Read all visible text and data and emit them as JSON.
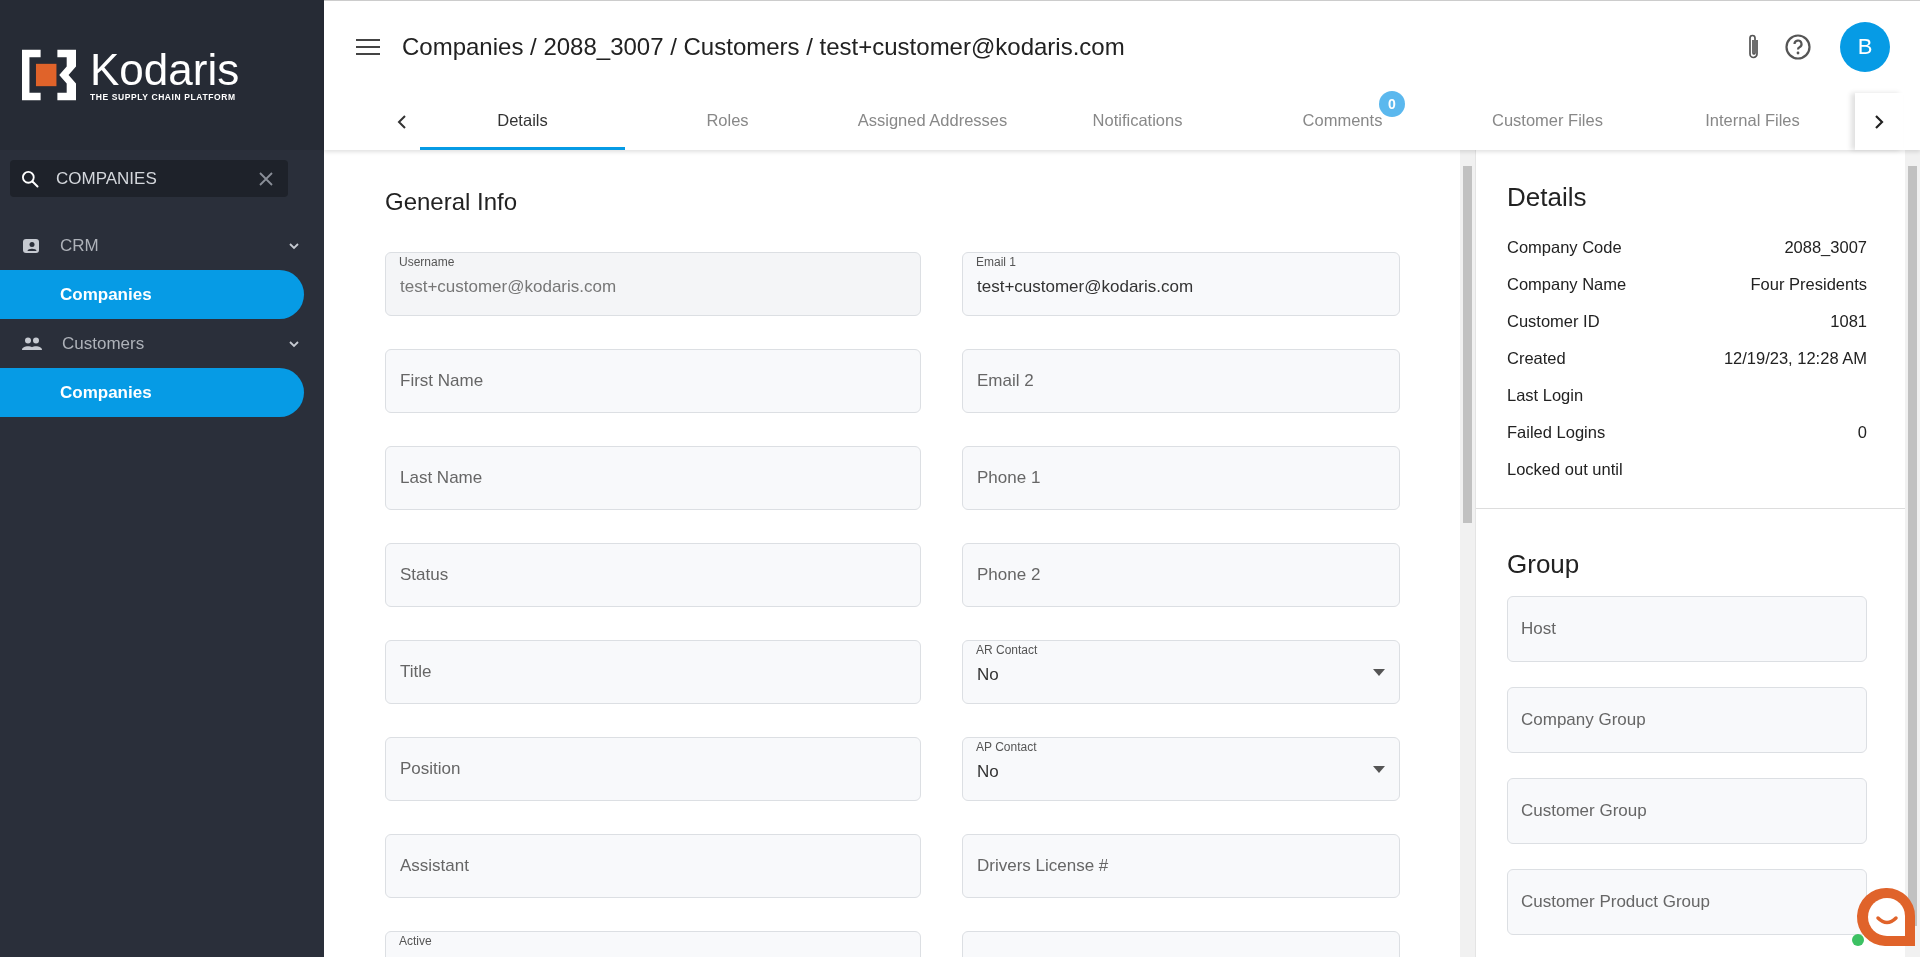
{
  "sidebar": {
    "logo": {
      "name": "Kodaris",
      "tagline": "THE SUPPLY CHAIN PLATFORM"
    },
    "search": {
      "value": "COMPANIES"
    },
    "groups": [
      {
        "label": "CRM",
        "expanded": true,
        "children": [
          {
            "label": "Companies",
            "selected": true
          }
        ]
      },
      {
        "label": "Customers",
        "expanded": true,
        "children": [
          {
            "label": "Companies",
            "selected": true
          }
        ]
      }
    ]
  },
  "header": {
    "breadcrumb": "Companies / 2088_3007 / Customers / test+customer@kodaris.com",
    "avatar": "B"
  },
  "tabs": [
    {
      "label": "Details",
      "selected": true
    },
    {
      "label": "Roles",
      "selected": false
    },
    {
      "label": "Assigned Addresses",
      "selected": false
    },
    {
      "label": "Notifications",
      "selected": false
    },
    {
      "label": "Comments",
      "selected": false,
      "badge": "0"
    },
    {
      "label": "Customer Files",
      "selected": false
    },
    {
      "label": "Internal Files",
      "selected": false
    }
  ],
  "form": {
    "title": "General Info",
    "rows": [
      [
        {
          "kind": "text",
          "label": "Username",
          "value": "test+customer@kodaris.com",
          "disabled": true
        },
        {
          "kind": "text",
          "label": "Email 1",
          "value": "test+customer@kodaris.com",
          "disabled": false
        }
      ],
      [
        {
          "kind": "text",
          "placeholder": "First Name",
          "disabled": false
        },
        {
          "kind": "text",
          "placeholder": "Email 2",
          "disabled": false
        }
      ],
      [
        {
          "kind": "text",
          "placeholder": "Last Name",
          "disabled": false
        },
        {
          "kind": "text",
          "placeholder": "Phone 1",
          "disabled": false
        }
      ],
      [
        {
          "kind": "text",
          "placeholder": "Status",
          "disabled": false
        },
        {
          "kind": "text",
          "placeholder": "Phone 2",
          "disabled": false
        }
      ],
      [
        {
          "kind": "text",
          "placeholder": "Title",
          "disabled": false
        },
        {
          "kind": "select",
          "label": "AR Contact",
          "value": "No",
          "disabled": false
        }
      ],
      [
        {
          "kind": "text",
          "placeholder": "Position",
          "disabled": false
        },
        {
          "kind": "select",
          "label": "AP Contact",
          "value": "No",
          "disabled": false
        }
      ],
      [
        {
          "kind": "text",
          "placeholder": "Assistant",
          "disabled": false
        },
        {
          "kind": "text",
          "placeholder": "Drivers License #",
          "disabled": false
        }
      ],
      [
        {
          "kind": "text",
          "label": "Active"
        },
        {
          "kind": "text"
        }
      ]
    ]
  },
  "details": {
    "title": "Details",
    "rows": [
      {
        "label": "Company Code",
        "value": "2088_3007"
      },
      {
        "label": "Company Name",
        "value": "Four Presidents"
      },
      {
        "label": "Customer ID",
        "value": "1081"
      },
      {
        "label": "Created",
        "value": "12/19/23, 12:28 AM"
      },
      {
        "label": "Last Login"
      },
      {
        "label": "Failed Logins",
        "value": "0"
      },
      {
        "label": "Locked out until"
      }
    ]
  },
  "group": {
    "title": "Group",
    "fields": [
      {
        "placeholder": "Host"
      },
      {
        "placeholder": "Company Group"
      },
      {
        "placeholder": "Customer Group"
      },
      {
        "placeholder": "Customer Product Group"
      }
    ]
  }
}
